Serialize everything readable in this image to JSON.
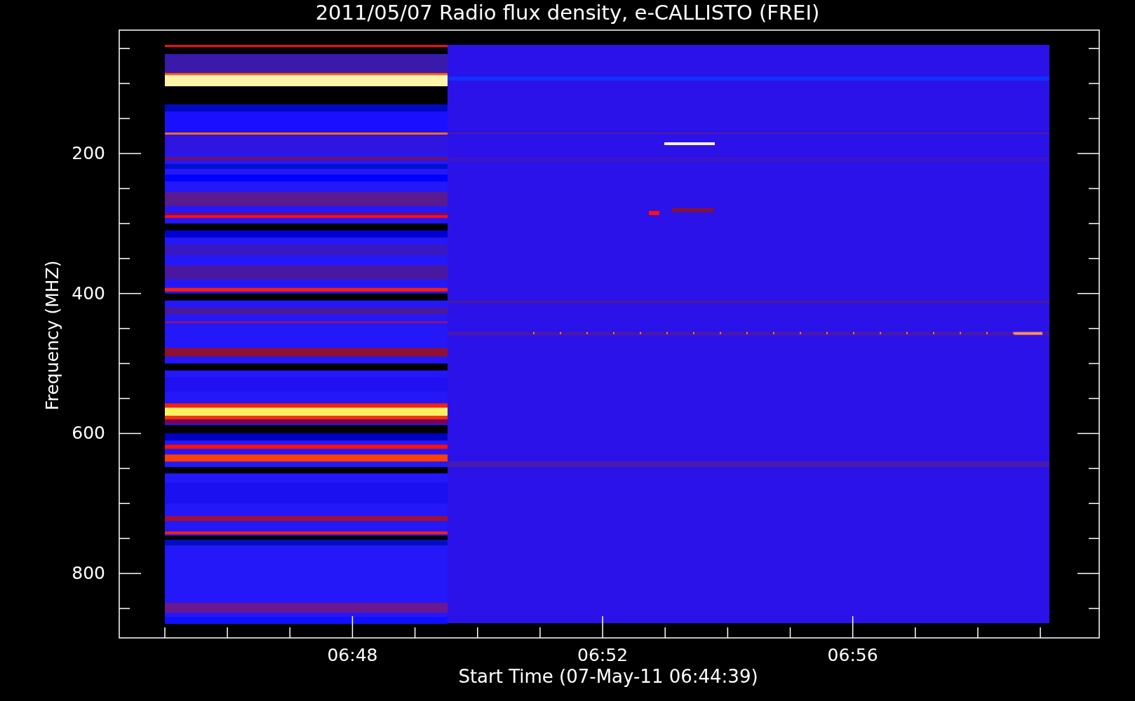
{
  "title": "2011/05/07  Radio flux density, e-CALLISTO (FREI)",
  "plot": {
    "ylabel": "Frequency (MHZ)",
    "xlabel": "Start Time (07-May-11 06:44:39)",
    "ytick_labels": [
      "200",
      "400",
      "600",
      "800"
    ],
    "xtick_labels": [
      "06:48",
      "06:52",
      "06:56"
    ]
  }
}
